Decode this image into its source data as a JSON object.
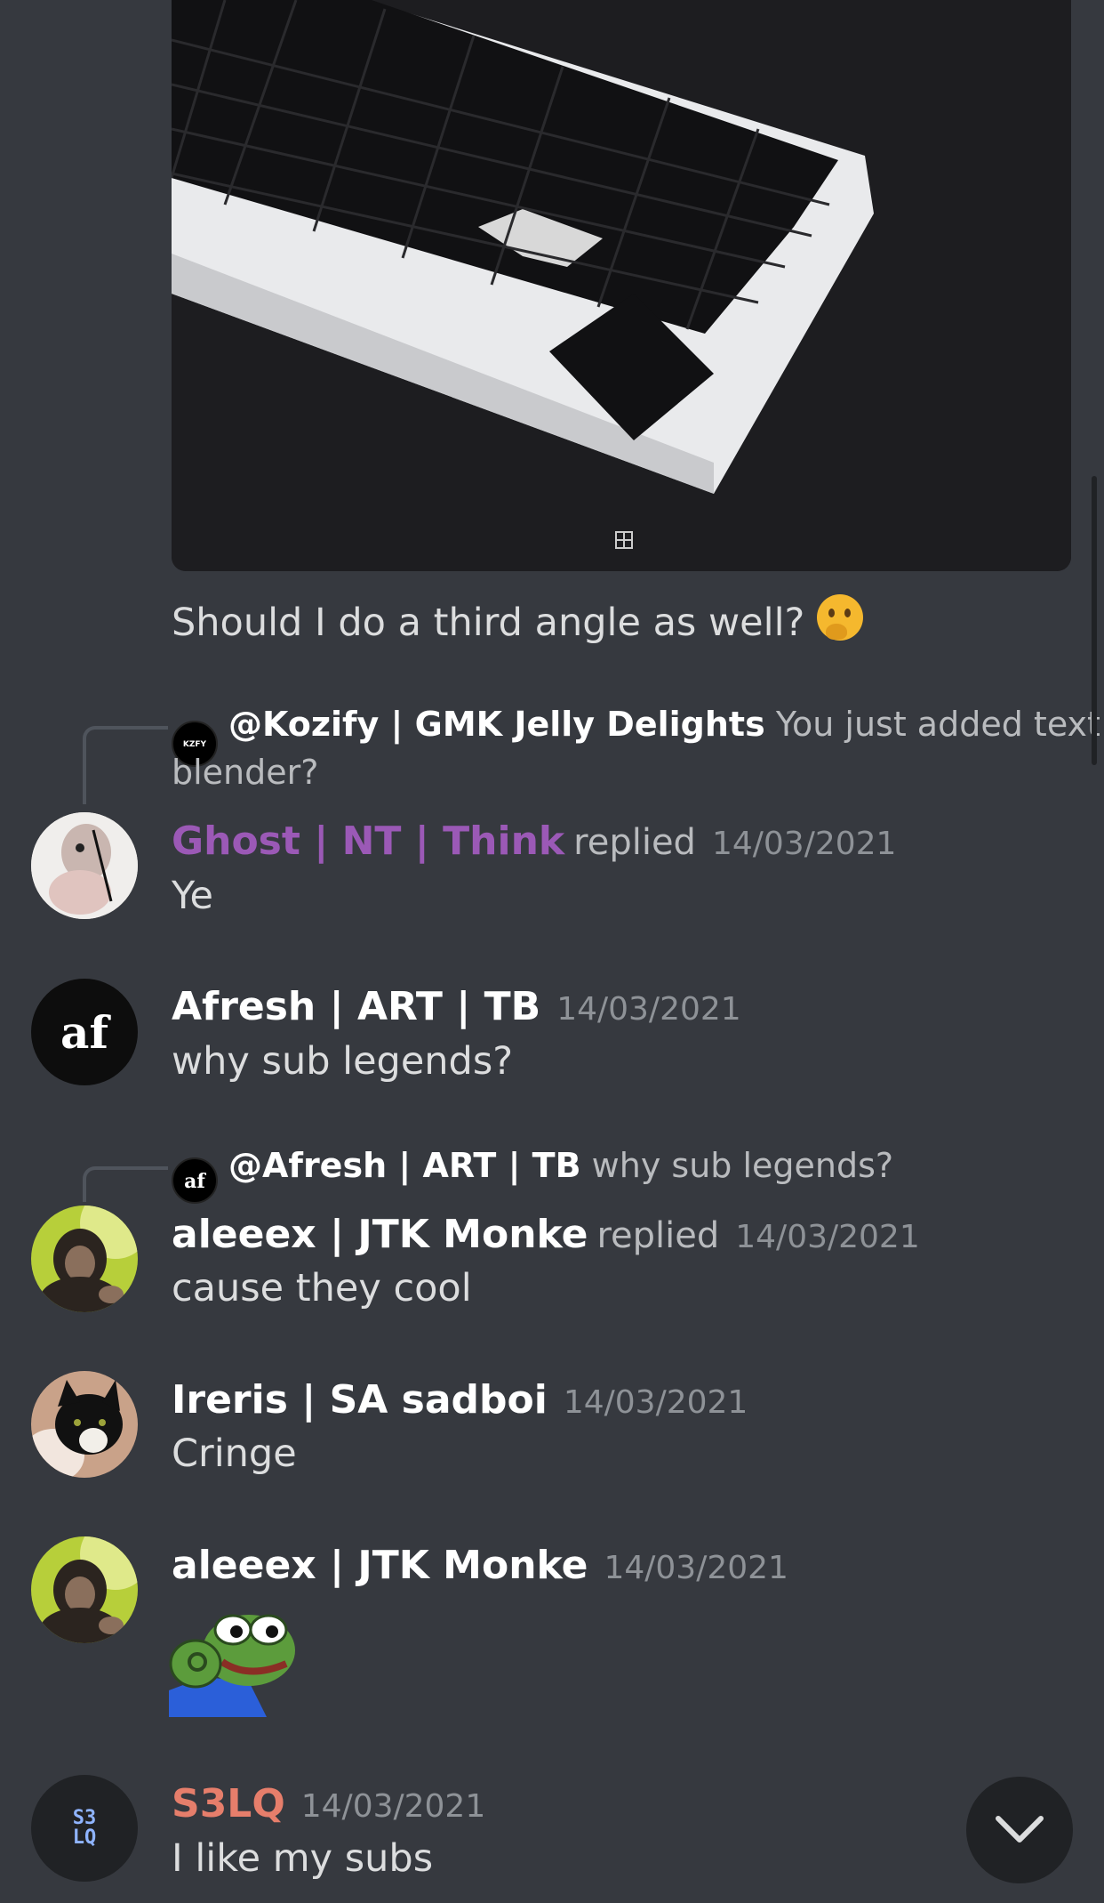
{
  "image_message": {
    "text": "Should I do a third angle as well?",
    "emoji": "thinking-face"
  },
  "messages": [
    {
      "reply_to": {
        "name": "@Kozify | GMK Jelly Delights",
        "snippet_line1": "You just added text in",
        "snippet_line2": "blender?"
      },
      "author": "Ghost | NT | Think",
      "author_color": "#9b59b6",
      "replied": "replied",
      "timestamp": "14/03/2021",
      "text": "Ye"
    },
    {
      "author": "Afresh | ART | TB",
      "avatar_text": "af",
      "timestamp": "14/03/2021",
      "text": "why sub legends?"
    },
    {
      "reply_to": {
        "name": "@Afresh | ART | TB",
        "snippet": "why sub legends?",
        "avatar_text": "af"
      },
      "author": "aleeex | JTK Monke",
      "replied": "replied",
      "timestamp": "14/03/2021",
      "text": "cause they cool"
    },
    {
      "author": "Ireris | SA sadboi",
      "timestamp": "14/03/2021",
      "text": "Cringe"
    },
    {
      "author": "aleeex | JTK Monke",
      "timestamp": "14/03/2021",
      "sticker": "pepe-ok-hand"
    },
    {
      "author": "S3LQ",
      "author_color": "#e67e6b",
      "avatar_text": "S3 LQ",
      "timestamp": "14/03/2021",
      "text": "I like my subs"
    }
  ],
  "controls": {
    "scroll_down_icon": "chevron-down-icon"
  }
}
